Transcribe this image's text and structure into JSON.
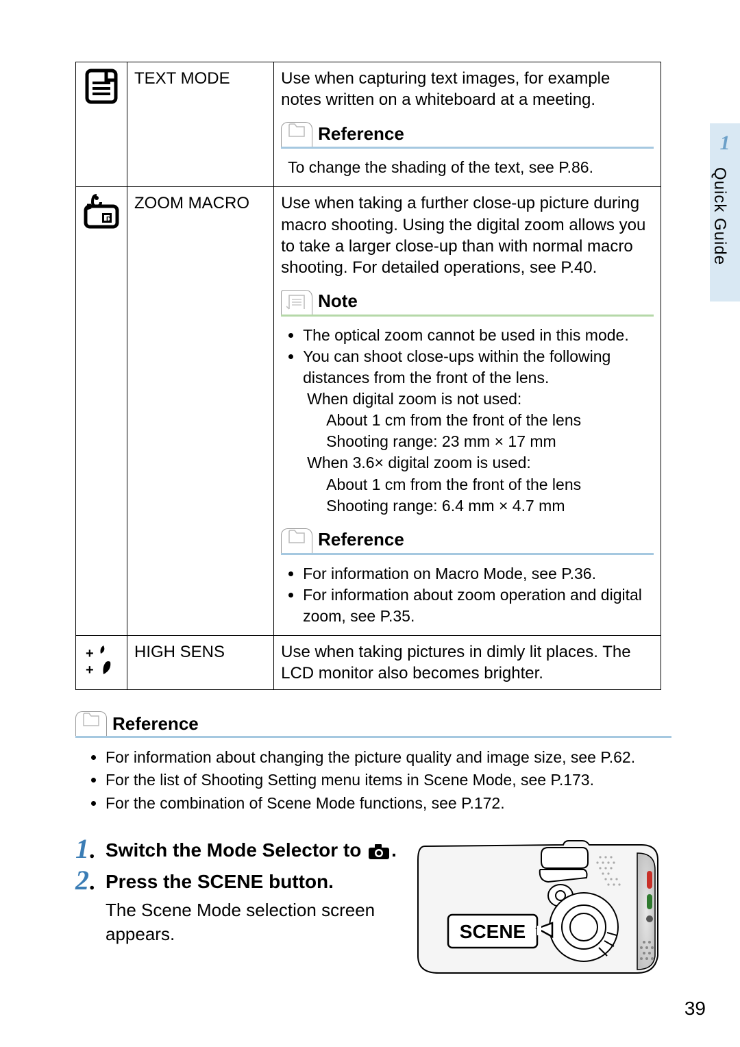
{
  "side": {
    "num": "1",
    "label": "Quick Guide"
  },
  "page_number": "39",
  "mode_icons": {
    "text": "text-document-icon",
    "zoom": "macro-zoom-icon",
    "sens": "high-sens-icon"
  },
  "rows": {
    "text": {
      "name": "TEXT MODE",
      "desc": "Use when capturing text images, for example notes written on a whiteboard at a meeting.",
      "ref_label": "Reference",
      "ref_body": "To change the shading of the text, see P.86."
    },
    "zoom": {
      "name": "ZOOM MACRO",
      "desc": "Use when taking a further close-up picture during macro shooting. Using the digital zoom allows you to take a larger close-up than with normal macro shooting. For detailed operations, see P.40.",
      "note_label": "Note",
      "note_items": [
        "The optical zoom cannot be used in this mode.",
        "You can shoot close-ups within the following distances from the front of the lens."
      ],
      "note_detail_lines": [
        "When digital zoom is not used:",
        "About 1 cm from the front of the lens",
        "Shooting range: 23 mm × 17 mm",
        "When 3.6× digital zoom is used:",
        "About 1 cm from the front of the lens",
        "Shooting range: 6.4 mm × 4.7 mm"
      ],
      "ref_label": "Reference",
      "ref_items": [
        "For information on Macro Mode, see P.36.",
        "For information about zoom operation and digital zoom, see P.35."
      ]
    },
    "sens": {
      "name": "HIGH SENS",
      "desc": "Use when taking pictures in dimly lit places. The LCD monitor also becomes brighter."
    }
  },
  "page_ref": {
    "label": "Reference",
    "items": [
      "For information about changing the picture quality and image size, see P.62.",
      "For the list of Shooting Setting menu items in Scene Mode, see P.173.",
      "For the combination of Scene Mode functions, see P.172."
    ]
  },
  "steps": {
    "s1": {
      "num": "1",
      "title_pre": "Switch the Mode Selector to ",
      "title_post": "."
    },
    "s2": {
      "num": "2",
      "title": "Press the SCENE button.",
      "sub": "The Scene Mode selection screen appears."
    }
  },
  "camera_label": "SCENE"
}
